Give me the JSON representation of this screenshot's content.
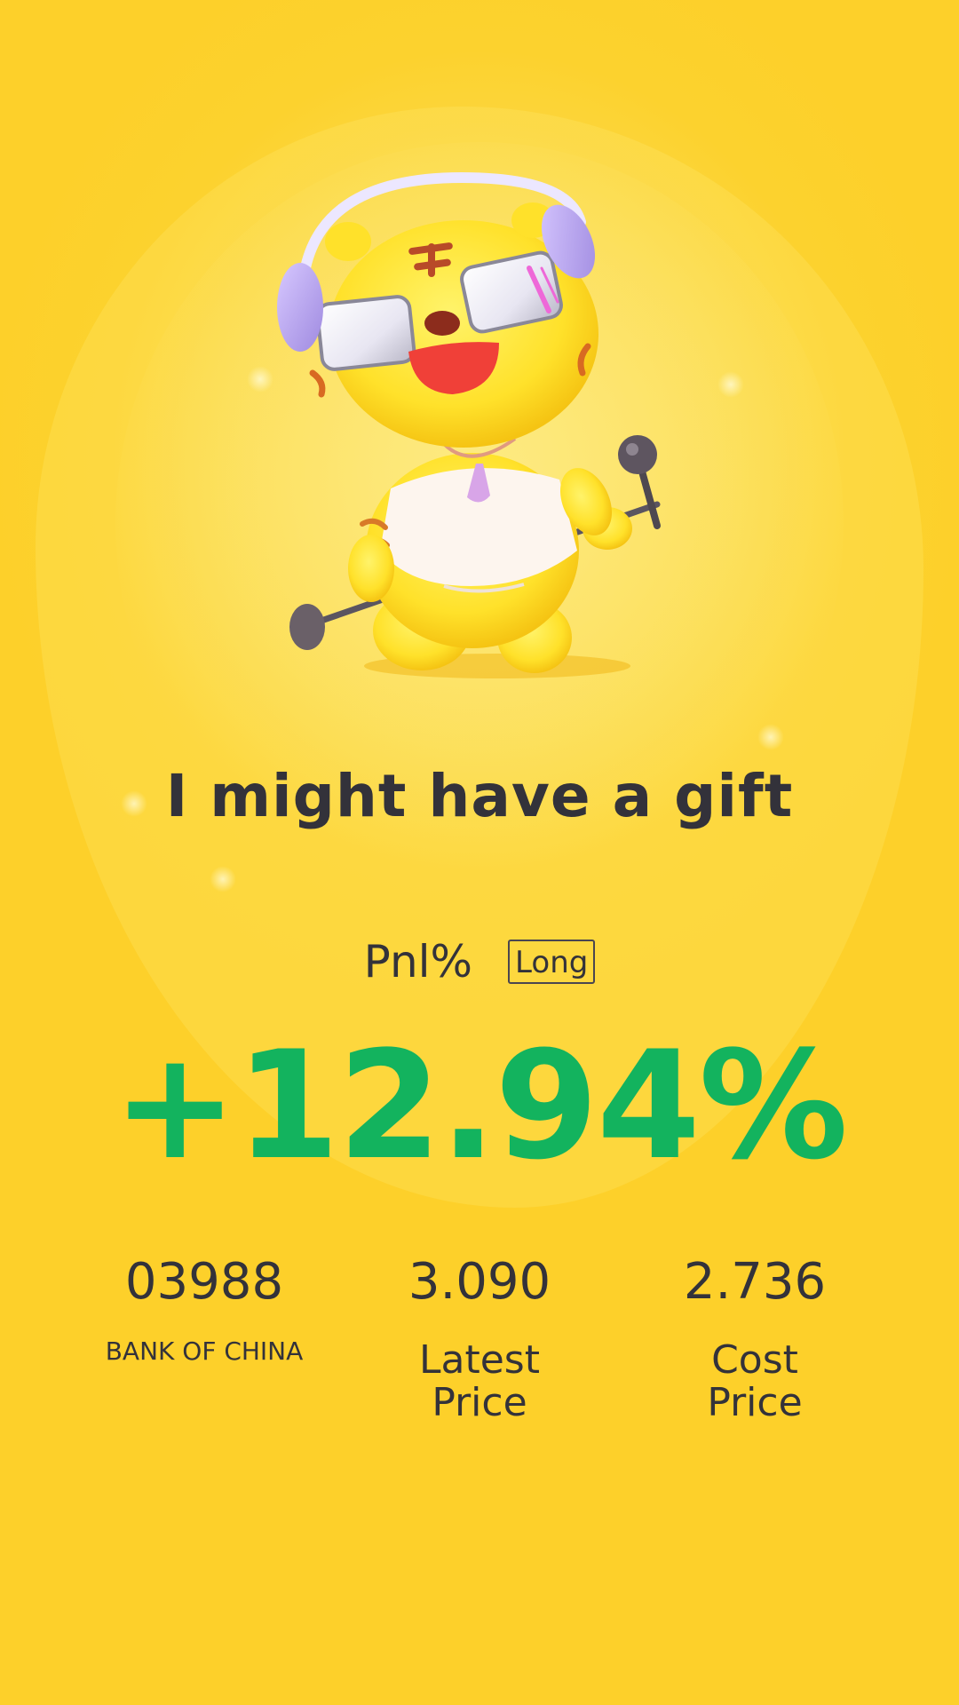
{
  "headline": "I might have a gift",
  "pnl": {
    "label": "Pnl%",
    "position_badge": "Long",
    "value": "+12.94%",
    "value_color": "#13b35e"
  },
  "stats": [
    {
      "value": "03988",
      "label": "BANK OF CHINA"
    },
    {
      "value": "3.090",
      "label": "Latest Price"
    },
    {
      "value": "2.736",
      "label": "Cost Price"
    }
  ],
  "mascot": {
    "icon": "tiger-mascot-with-headphones-and-microphone-icon"
  },
  "colors": {
    "background": "#fcd22e",
    "text": "#33323a",
    "profit": "#13b35e"
  }
}
